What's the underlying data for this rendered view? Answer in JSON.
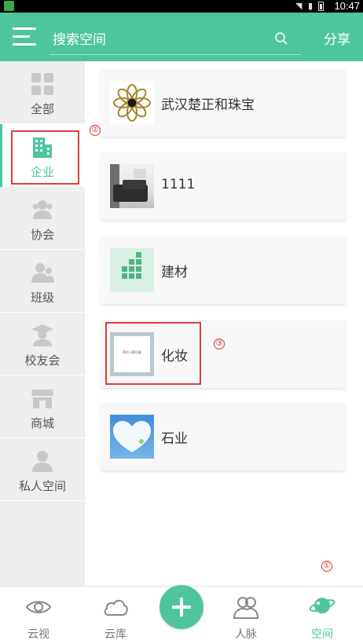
{
  "status_bar": {
    "time": "10:47"
  },
  "header": {
    "search_placeholder": "搜索空间",
    "share_label": "分享"
  },
  "sidebar": {
    "items": [
      {
        "label": "全部",
        "icon": "grid-icon"
      },
      {
        "label": "企业",
        "icon": "building-icon"
      },
      {
        "label": "协会",
        "icon": "association-icon"
      },
      {
        "label": "班级",
        "icon": "class-icon"
      },
      {
        "label": "校友会",
        "icon": "alumni-icon"
      },
      {
        "label": "商城",
        "icon": "store-icon"
      },
      {
        "label": "私人空间",
        "icon": "person-icon"
      }
    ],
    "active_index": 1
  },
  "spaces": [
    {
      "title": "武汉楚正和珠宝",
      "thumb": "jewelry-logo-image"
    },
    {
      "title": "1111",
      "thumb": "sofa-photo-image"
    },
    {
      "title": "建材",
      "thumb": "blocks-icon"
    },
    {
      "title": "化妆",
      "thumb": "cosmetics-thumbnail-image",
      "thumb_caption": "四大人群可爱"
    },
    {
      "title": "石业",
      "thumb": "heart-cloud-image"
    }
  ],
  "annotations": [
    "①",
    "②",
    "③"
  ],
  "bottom_nav": {
    "items": [
      {
        "label": "云视",
        "icon": "eye-icon"
      },
      {
        "label": "云库",
        "icon": "cloud-icon"
      },
      {
        "label": "人脉",
        "icon": "contacts-icon"
      },
      {
        "label": "空间",
        "icon": "planet-icon"
      }
    ],
    "add_icon": "plus-icon"
  },
  "colors": {
    "accent": "#4fc59f",
    "annotation": "#e23c3c"
  }
}
